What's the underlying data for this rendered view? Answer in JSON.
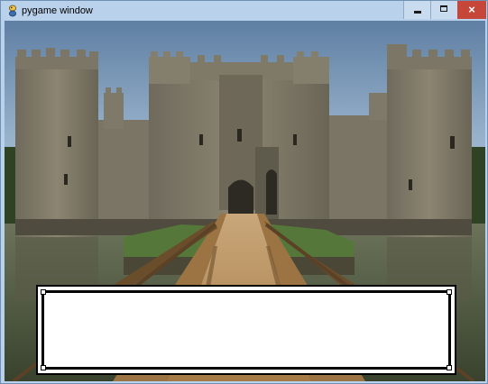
{
  "window": {
    "title": "pygame window",
    "controls": {
      "minimize_icon": "minimize-icon",
      "maximize_icon": "maximize-icon",
      "close_icon": "close-icon",
      "close_glyph": "×"
    }
  },
  "scene": {
    "description_icon": "castle-scene",
    "colors": {
      "sky": "#7c9fc0",
      "stone": "#7f7a6a",
      "water": "#5c6b4e",
      "grass": "#5f7d3c",
      "bridge": "#b58b58"
    }
  },
  "dialog": {
    "text": ""
  }
}
